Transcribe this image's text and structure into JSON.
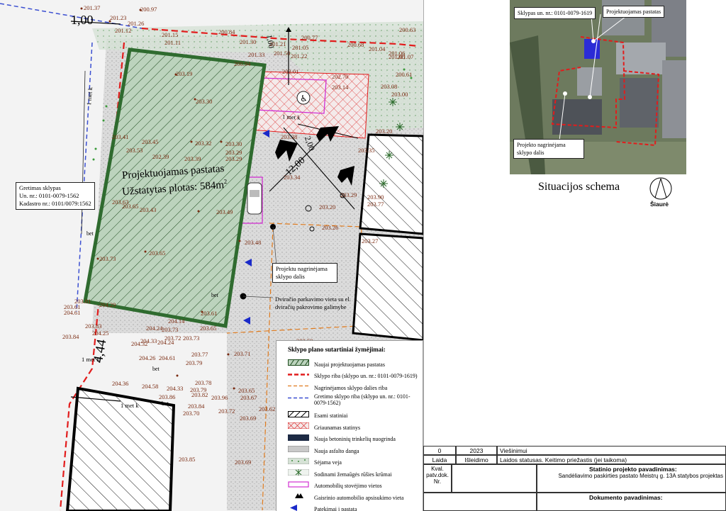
{
  "plan": {
    "top_scale_label": "1,00",
    "dim_vertical": "4,44",
    "dim_diag_1": "12,00",
    "dim_diag_2": "2,00",
    "building_name": "Projektuojamas pastatas",
    "building_area": "Užstatytas plotas: 584m",
    "building_area_sup": "2",
    "met_k_labels": [
      "1 met k",
      "1 met k",
      "1 met k",
      "1 met k"
    ],
    "bet_labels": [
      "bet",
      "bet",
      "bet",
      "bet"
    ],
    "neighbor_box": {
      "line1": "Gretimas sklypas",
      "line2": "Un. nr.: 0101-0079-1562",
      "line3": "Kadastro nr.: 0101/0079:1562"
    },
    "callout_part": "Projektu nagrinėjama sklypo dalis",
    "callout_bike": "Dviračio parkavimo vieta su el. dviračių pakrovimo galimybe",
    "elevations": [
      "201.37",
      "200.97",
      "201.23",
      "201.26",
      "201.12",
      "201.15",
      "200.84",
      "201.30",
      "200.77",
      "201.21",
      "201.05",
      "201.04",
      "200.68",
      "201.06",
      "200.63",
      "201.05",
      "200.61",
      "201.33",
      "201.11",
      "200.94",
      "201.50",
      "201.22",
      "201.07",
      "203.19",
      "202.70",
      "203.01",
      "203.14",
      "203.08",
      "203.00",
      "203.30",
      "203.20",
      "203.38",
      "203.35",
      "203.45",
      "203.32",
      "203.30",
      "203.29",
      "203.29",
      "203.53",
      "202.39",
      "203.39",
      "203.34",
      "203.41",
      "203.29",
      "203.90",
      "203.77",
      "203.63",
      "203.65",
      "203.43",
      "203.20",
      "203.26",
      "203.49",
      "203.27",
      "203.48",
      "203.73",
      "203.65",
      "203.61",
      "204.29",
      "204.14",
      "203.73",
      "203.65",
      "203.83",
      "204.25",
      "204.24",
      "203.72",
      "203.73",
      "203.84",
      "204.33",
      "204.24",
      "204.61",
      "203.77",
      "203.71",
      "204.26",
      "203.79",
      "204.32",
      "204.36",
      "204.58",
      "203.78",
      "203.65",
      "204.33",
      "203.86",
      "203.82",
      "203.79",
      "203.67",
      "203.96",
      "203.84",
      "203.72",
      "203.62",
      "203.69",
      "203.70",
      "203.85",
      "203.69",
      "203.58",
      "204.61",
      "203.61",
      "203.81"
    ]
  },
  "legend": {
    "title": "Sklypo plano sutartiniai žymėjimai:",
    "items": [
      {
        "label": "Naujai projektuojamas pastatas",
        "sym": "hatch-green"
      },
      {
        "label": "Sklypo riba (sklypo un. nr.: 0101-0079-1619)",
        "sym": "red-dash"
      },
      {
        "label": "Nagrinėjamos sklypo dalies riba",
        "sym": "orange-dash"
      },
      {
        "label": "Gretimo sklypo riba (sklypo un. nr.: 0101-0079-1562)",
        "sym": "blue-dash"
      },
      {
        "label": "Esami statiniai",
        "sym": "black-hatch"
      },
      {
        "label": "Griaunamas statinys",
        "sym": "red-hatch"
      },
      {
        "label": "Nauja betoninių trinkelių nuogrinda",
        "sym": "dark-fill"
      },
      {
        "label": "Nauja asfalto danga",
        "sym": "gray-fill"
      },
      {
        "label": "Sėjama veja",
        "sym": "green-dots"
      },
      {
        "label": "Sodinami žemaūgės rūšies krūmai",
        "sym": "shrub"
      },
      {
        "label": "Automobilių stovėjimo vietos",
        "sym": "magenta-box"
      },
      {
        "label": "Gaisrinio automobilio apsisukimo vieta",
        "sym": "arrows"
      },
      {
        "label": "Patekimai į pastatą",
        "sym": "blue-tri"
      }
    ]
  },
  "situation": {
    "label_plot": "Sklypas un. nr.: 0101-0079-1619",
    "label_building": "Projektuojamas pastatas",
    "label_part": "Projekto nagrinėjama sklypo dalis",
    "title": "Situacijos schema",
    "north": "Šiaurė"
  },
  "title_block": {
    "rev_no": "0",
    "rev_year": "2023",
    "rev_status": "Viešinimui",
    "h_laida": "Laida",
    "h_date": "Išleidimo data",
    "h_status": "Laidos statusas. Keitimo priežastis (jei taikoma)",
    "qual": "Kval. patv.dok. Nr.",
    "project_name_label": "Statinio projekto pavadinimas:",
    "project_name": "Sandėliavimo paskirties pastato Meistrų g. 13A statybos projektas",
    "doc_name_label": "Dokumento pavadinimas:"
  },
  "colors": {
    "building_green": "#2f6b2f",
    "plot_red": "#e21c1c",
    "part_orange": "#e07a1c",
    "neighbor_blue": "#3b4fd1",
    "elev_brown": "#7a2a10"
  }
}
